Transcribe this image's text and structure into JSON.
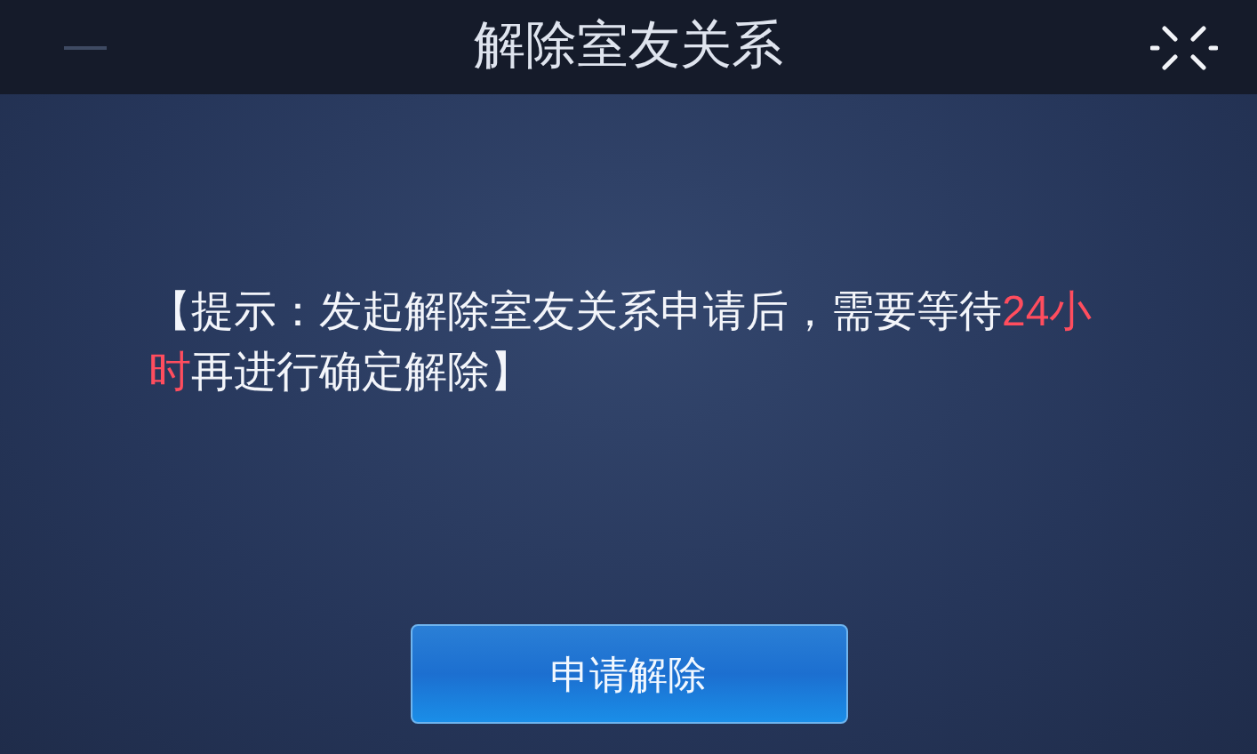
{
  "header": {
    "title": "解除室友关系"
  },
  "notice": {
    "parts": [
      {
        "text": "【提示：发起解除室友关系申请后，需要等待",
        "highlight": false
      },
      {
        "text": "24小时",
        "highlight": true
      },
      {
        "text": "再进行确定解除】",
        "highlight": false
      }
    ]
  },
  "buttons": [
    {
      "label": "申请解除"
    }
  ]
}
